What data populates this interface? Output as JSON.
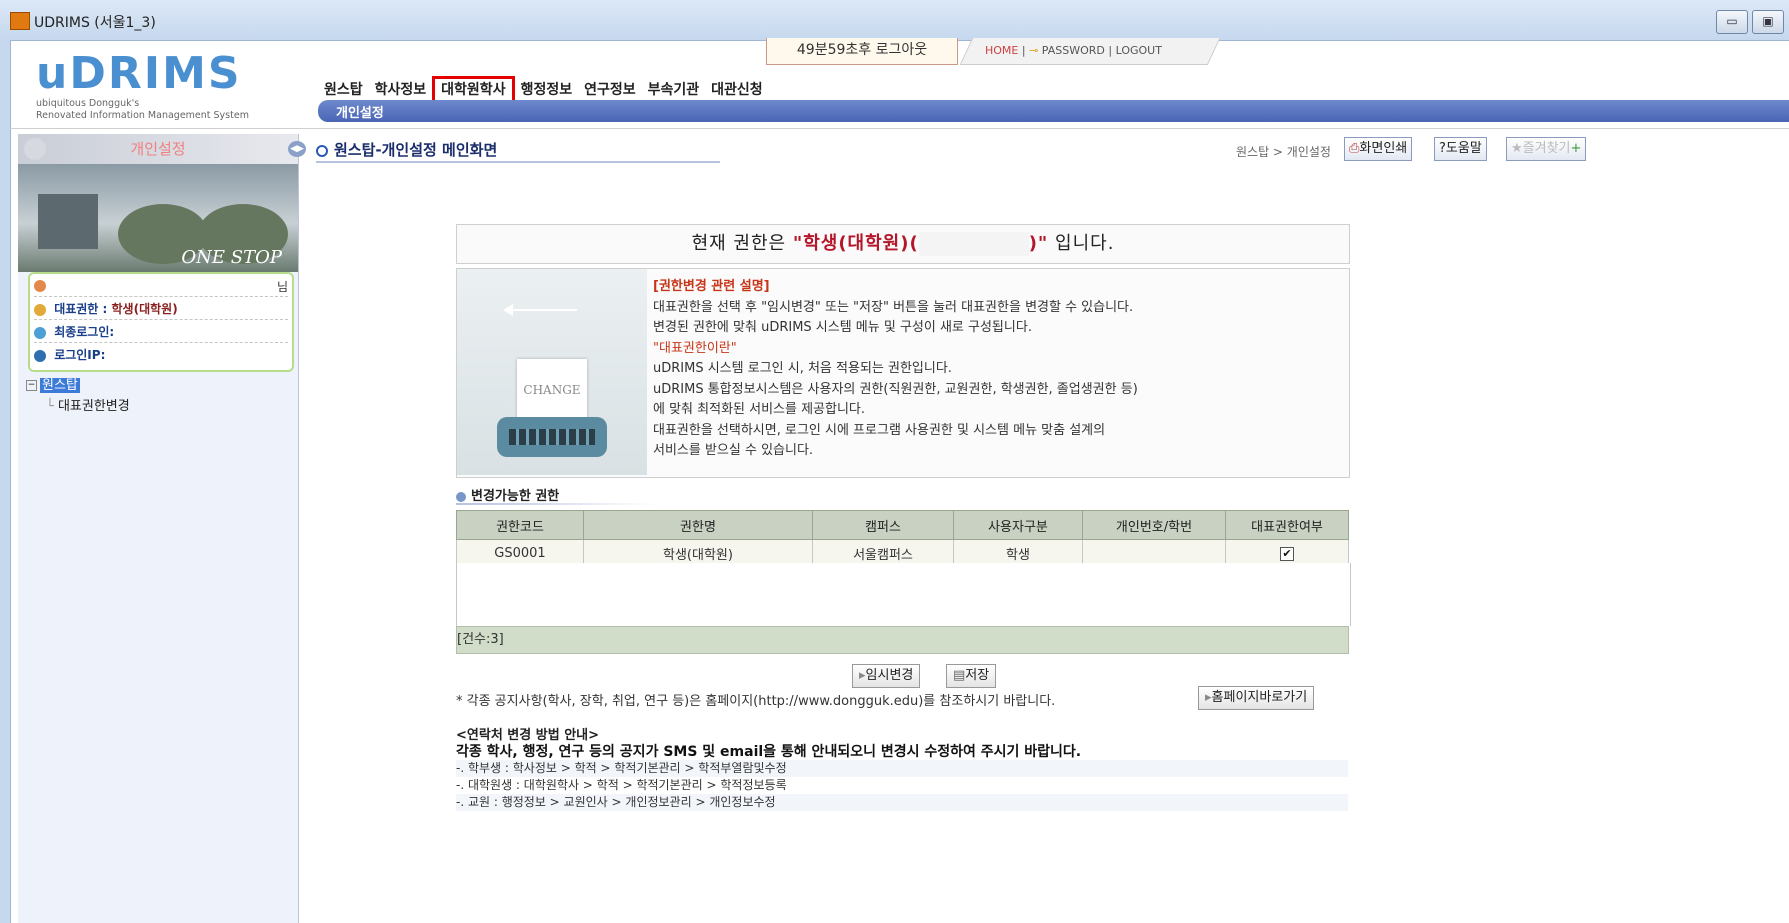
{
  "window": {
    "title": "UDRIMS (서울1_3)"
  },
  "header": {
    "logo": "uDRIMS",
    "logo_sub_1": "ubiquitous Dongguk's",
    "logo_sub_2": "Renovated Information Management System",
    "logout_timer": "49분59초후 로그아웃",
    "links": {
      "home": "HOME",
      "password": "PASSWORD",
      "logout": "LOGOUT"
    }
  },
  "gnb": [
    {
      "label": "원스탑",
      "selected": false
    },
    {
      "label": "학사정보",
      "selected": false
    },
    {
      "label": "대학원학사",
      "selected": true
    },
    {
      "label": "행정정보",
      "selected": false
    },
    {
      "label": "연구정보",
      "selected": false
    },
    {
      "label": "부속기관",
      "selected": false
    },
    {
      "label": "대관신청",
      "selected": false
    }
  ],
  "subnav": {
    "item": "개인설정"
  },
  "left": {
    "title": "개인설정",
    "banner": "ONE STOP",
    "user_suffix": "님",
    "role_label": "대표권한 :",
    "role_value": "학생(대학원)",
    "last_login_label": "최종로그인:",
    "login_ip_label": "로그인IP:",
    "tree_root": "원스탑",
    "tree_child": "대표권한변경"
  },
  "main": {
    "title": "원스탑-개인설정 메인화면",
    "breadcrumb": "원스탑 > 개인설정",
    "btn_print": "화면인쇄",
    "btn_help": "도움말",
    "btn_fav": "즐겨찾기",
    "role_prefix": "현재 권한은 ",
    "role_value": "\"학생(대학원)(",
    "role_close": ")\"",
    "role_suffix": " 입니다."
  },
  "info": {
    "image_text": "CHANGE",
    "heading": "[권한변경 관련 설명]",
    "line1": "대표권한을 선택 후 \"임시변경\" 또는 \"저장\" 버튼을 눌러 대표권한을 변경할 수 있습니다.",
    "line2": "변경된 권한에 맞춰 uDRIMS 시스템 메뉴 및 구성이 새로 구성됩니다.",
    "heading2": "\"대표권한이란\"",
    "line3": "uDRIMS 시스템 로그인 시, 처음 적용되는 권한입니다.",
    "line4": "uDRIMS 통합정보시스템은 사용자의 권한(직원권한, 교원권한, 학생권한, 졸업생권한 등)",
    "line5": "에 맞춰 최적화된 서비스를 제공합니다.",
    "line6": "대표권한을 선택하시면, 로그인 시에 프로그램 사용권한 및 시스템 메뉴 맞춤 설계의",
    "line7": "서비스를 받으실 수 있습니다."
  },
  "grid": {
    "section_title": "변경가능한 권한",
    "headers": [
      "권한코드",
      "권한명",
      "캠퍼스",
      "사용자구분",
      "개인번호/학번",
      "대표권한여부"
    ],
    "rows": [
      [
        "GS0001",
        "학생(대학원)",
        "서울캠퍼스",
        "학생",
        "",
        "✔"
      ]
    ],
    "count": "[건수:3]"
  },
  "actions": {
    "temp_change": "임시변경",
    "save": "저장",
    "notice": "* 각종 공지사항(학사, 장학, 취업, 연구 등)은 홈페이지(http://www.dongguk.edu)를 참조하시기 바랍니다.",
    "homepage": "홈페이지바로가기"
  },
  "contact": {
    "title": "<연락처 변경 방법 안내>",
    "desc": "각종 학사, 행정, 연구 등의 공지가 SMS 및 email을 통해 안내되오니 변경시 수정하여 주시기 바랍니다.",
    "items": [
      "-. 학부생 : 학사정보 > 학적 > 학적기본관리 > 학적부열람및수정",
      "-. 대학원생 : 대학원학사 > 학적 > 학적기본관리 > 학적정보등록",
      "-. 교원 : 행정정보 > 교원인사 > 개인정보관리 > 개인정보수정"
    ]
  },
  "colors": {
    "accent": "#4a65b5",
    "highlight": "#e40000",
    "role": "#b5172a"
  }
}
